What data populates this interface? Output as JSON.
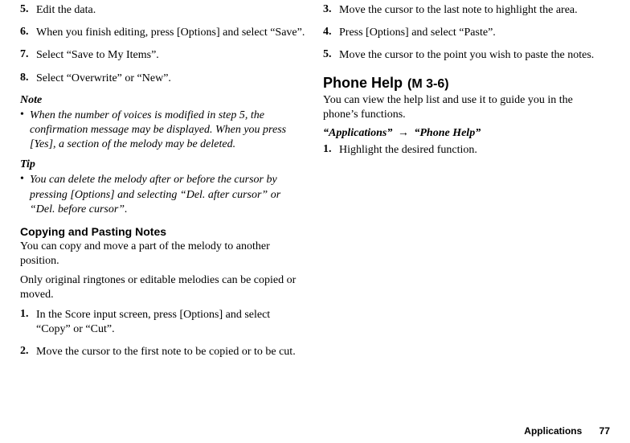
{
  "left": {
    "steps_a": [
      {
        "n": "5.",
        "txt": "Edit the data."
      },
      {
        "n": "6.",
        "txt": "When you finish editing, press [Options] and select “Save”."
      },
      {
        "n": "7.",
        "txt": "Select “Save to My Items”."
      },
      {
        "n": "8.",
        "txt": "Select “Overwrite” or “New”."
      }
    ],
    "note_label": "Note",
    "note_text": "When the number of voices is modified in step 5, the confirmation message may be displayed. When you press [Yes], a section of the melody may be deleted.",
    "tip_label": "Tip",
    "tip_text": "You can delete the melody after or before the cursor by pressing [Options] and selecting “Del. after cursor” or “Del. before cursor”.",
    "section2_heading": "Copying and Pasting Notes",
    "section2_p1": "You can copy and move a part of the melody to another position.",
    "section2_p2": "Only original ringtones or editable melodies can be copied or moved.",
    "steps_b": [
      {
        "n": "1.",
        "txt": "In the Score input screen, press [Options] and select “Copy” or “Cut”."
      },
      {
        "n": "2.",
        "txt": "Move the cursor to the first note to be copied or to be cut."
      }
    ]
  },
  "right": {
    "steps_c": [
      {
        "n": "3.",
        "txt": "Move the cursor to the last note to highlight the area."
      },
      {
        "n": "4.",
        "txt": "Press [Options] and select “Paste”."
      },
      {
        "n": "5.",
        "txt": "Move the cursor to the point you wish to paste the notes."
      }
    ],
    "heading_main": "Phone Help",
    "heading_code": "(M 3-6)",
    "para": "You can view the help list and use it to guide you in the phone’s functions.",
    "nav1": "“Applications”",
    "arrow": "→",
    "nav2": "“Phone Help”",
    "steps_d": [
      {
        "n": "1.",
        "txt": "Highlight the desired function."
      }
    ]
  },
  "footer": {
    "label": "Applications",
    "pagenum": "77"
  }
}
